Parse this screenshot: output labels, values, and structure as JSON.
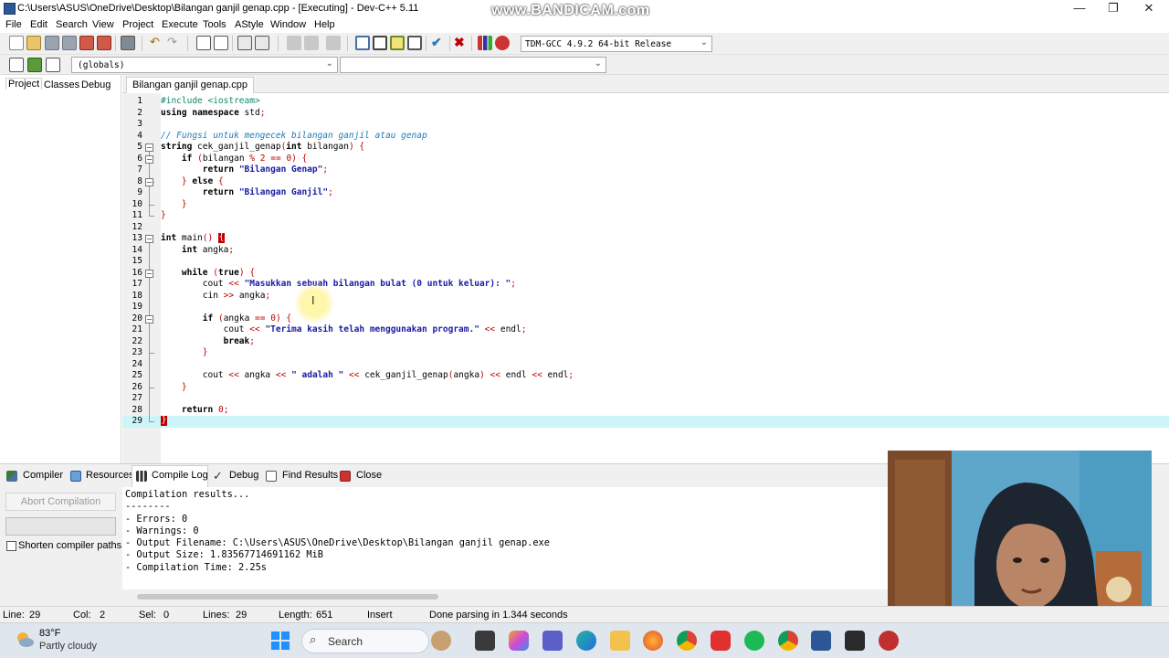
{
  "window": {
    "title": "C:\\Users\\ASUS\\OneDrive\\Desktop\\Bilangan ganjil genap.cpp - [Executing] - Dev-C++ 5.11",
    "watermark": "www.BANDICAM.com",
    "minimize": "—",
    "maximize": "❐",
    "close": "✕"
  },
  "menu": [
    "File",
    "Edit",
    "Search",
    "View",
    "Project",
    "Execute",
    "Tools",
    "AStyle",
    "Window",
    "Help"
  ],
  "toolbar": {
    "compiler": "TDM-GCC 4.9.2 64-bit Release",
    "scope": "(globals)",
    "member": ""
  },
  "left_panel": {
    "tabs": [
      "Project",
      "Classes",
      "Debug"
    ]
  },
  "editor": {
    "file_tab": "Bilangan ganjil genap.cpp",
    "lines": [
      "#include <iostream>",
      "using namespace std;",
      "",
      "// Fungsi untuk mengecek bilangan ganjil atau genap",
      "string cek_ganjil_genap(int bilangan) {",
      "    if (bilangan % 2 == 0) {",
      "        return \"Bilangan Genap\";",
      "    } else {",
      "        return \"Bilangan Ganjil\";",
      "    }",
      "}",
      "",
      "int main() {",
      "    int angka;",
      "",
      "    while (true) {",
      "        cout << \"Masukkan sebuah bilangan bulat (0 untuk keluar): \";",
      "        cin >> angka;",
      "",
      "        if (angka == 0) {",
      "            cout << \"Terima kasih telah menggunakan program.\" << endl;",
      "            break;",
      "        }",
      "",
      "        cout << angka << \" adalah \" << cek_ganjil_genap(angka) << endl << endl;",
      "    }",
      "",
      "    return 0;",
      "}"
    ],
    "line_numbers": [
      "1",
      "2",
      "3",
      "4",
      "5",
      "6",
      "7",
      "8",
      "9",
      "10",
      "11",
      "12",
      "13",
      "14",
      "15",
      "16",
      "17",
      "18",
      "19",
      "20",
      "21",
      "22",
      "23",
      "24",
      "25",
      "26",
      "27",
      "28",
      "29"
    ]
  },
  "bottom_panel": {
    "tabs": [
      "Compiler",
      "Resources",
      "Compile Log",
      "Debug",
      "Find Results",
      "Close"
    ],
    "abort_button": "Abort Compilation",
    "shorten_label": "Shorten compiler paths",
    "log": "Compilation results...\n--------\n- Errors: 0\n- Warnings: 0\n- Output Filename: C:\\Users\\ASUS\\OneDrive\\Desktop\\Bilangan ganjil genap.exe\n- Output Size: 1.83567714691162 MiB\n- Compilation Time: 2.25s"
  },
  "status_bar": {
    "line_label": "Line:",
    "line_value": "29",
    "col_label": "Col:",
    "col_value": "2",
    "sel_label": "Sel:",
    "sel_value": "0",
    "lines_label": "Lines:",
    "lines_value": "29",
    "length_label": "Length:",
    "length_value": "651",
    "mode": "Insert",
    "message": "Done parsing in 1.344 seconds"
  },
  "taskbar": {
    "temperature": "83°F",
    "weather": "Partly cloudy",
    "search": "Search"
  },
  "colors": {
    "accent": "#c00000",
    "current_line": "#ccf5f7",
    "comment": "#1f7ab7",
    "string": "#1a1aa6"
  }
}
